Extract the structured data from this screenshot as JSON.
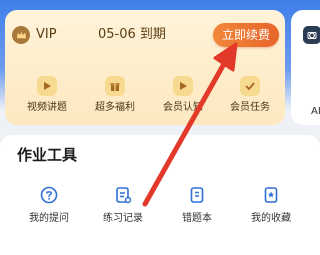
{
  "vip": {
    "label": "VIP",
    "expiry": "05-06 到期",
    "renew_label": "立即续费",
    "items": [
      {
        "label": "视频讲题",
        "icon": "play-icon"
      },
      {
        "label": "超多福利",
        "icon": "gift-icon"
      },
      {
        "label": "会员认知",
        "icon": "play-icon"
      },
      {
        "label": "会员任务",
        "icon": "check-icon"
      }
    ]
  },
  "side_card": {
    "label": "AI",
    "icon": "camera-icon"
  },
  "tools": {
    "title": "作业工具",
    "items": [
      {
        "label": "我的提问",
        "icon": "question-icon"
      },
      {
        "label": "练习记录",
        "icon": "record-icon"
      },
      {
        "label": "错题本",
        "icon": "notebook-icon"
      },
      {
        "label": "我的收藏",
        "icon": "bookmark-icon"
      }
    ]
  },
  "colors": {
    "accent": "#e8652a",
    "vip_bg": "#fde8c0",
    "tool_icon": "#2f6fd6",
    "annotation_arrow": "#e2392b"
  }
}
